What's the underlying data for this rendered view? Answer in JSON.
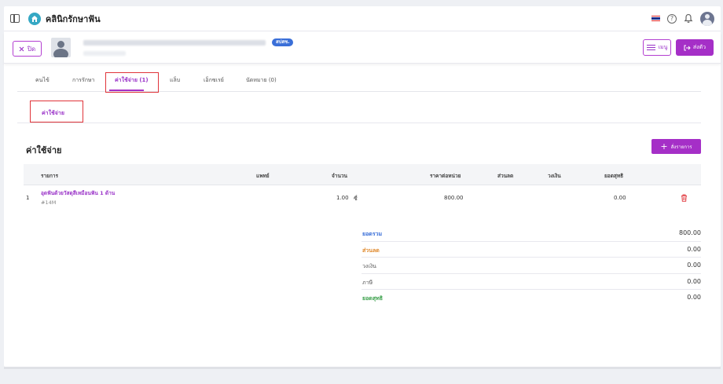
{
  "header": {
    "app_title": "คลินิกรักษาฟัน"
  },
  "patient_bar": {
    "close_label": "ปิด",
    "badge": "สปสช.",
    "menu_label": "เมนู",
    "send_label": "ส่งตัว"
  },
  "tabs": [
    {
      "label": "คนไข้"
    },
    {
      "label": "การรักษา"
    },
    {
      "label": "ค่าใช้จ่าย (1)"
    },
    {
      "label": "แล็บ"
    },
    {
      "label": "เอ็กซเรย์"
    },
    {
      "label": "นัดหมาย (0)"
    }
  ],
  "subtab": "ค่าใช้จ่าย",
  "section": {
    "title": "ค่าใช้จ่าย",
    "add_label": "สั่งรายการ"
  },
  "table": {
    "headers": [
      "รายการ",
      "แพทย์",
      "จำนวน",
      "ราคาต่อหน่วย",
      "ส่วนลด",
      "วงเงิน",
      "ยอดสุทธิ"
    ],
    "rows": [
      {
        "index": "1",
        "name": "อุดฟันด้วยวัสดุสีเหมือนฟัน 1 ด้าน",
        "code": "#14M",
        "doctor": "",
        "qty": "1.00",
        "unit": "ซี่",
        "unit_price": "800.00",
        "discount": "",
        "limit": "",
        "net": "0.00"
      }
    ]
  },
  "summary": [
    {
      "label": "ยอดรวม",
      "value": "800.00",
      "color": "#3a6fd8"
    },
    {
      "label": "ส่วนลด",
      "value": "0.00",
      "color": "#e08a2e"
    },
    {
      "label": "วงเงิน",
      "value": "0.00",
      "color": "#555555"
    },
    {
      "label": "ภาษี",
      "value": "0.00",
      "color": "#555555"
    },
    {
      "label": "ยอดสุทธิ",
      "value": "0.00",
      "color": "#3aa04a"
    }
  ],
  "colors": {
    "accent": "#a52fc7",
    "highlight": "#e0343a"
  }
}
